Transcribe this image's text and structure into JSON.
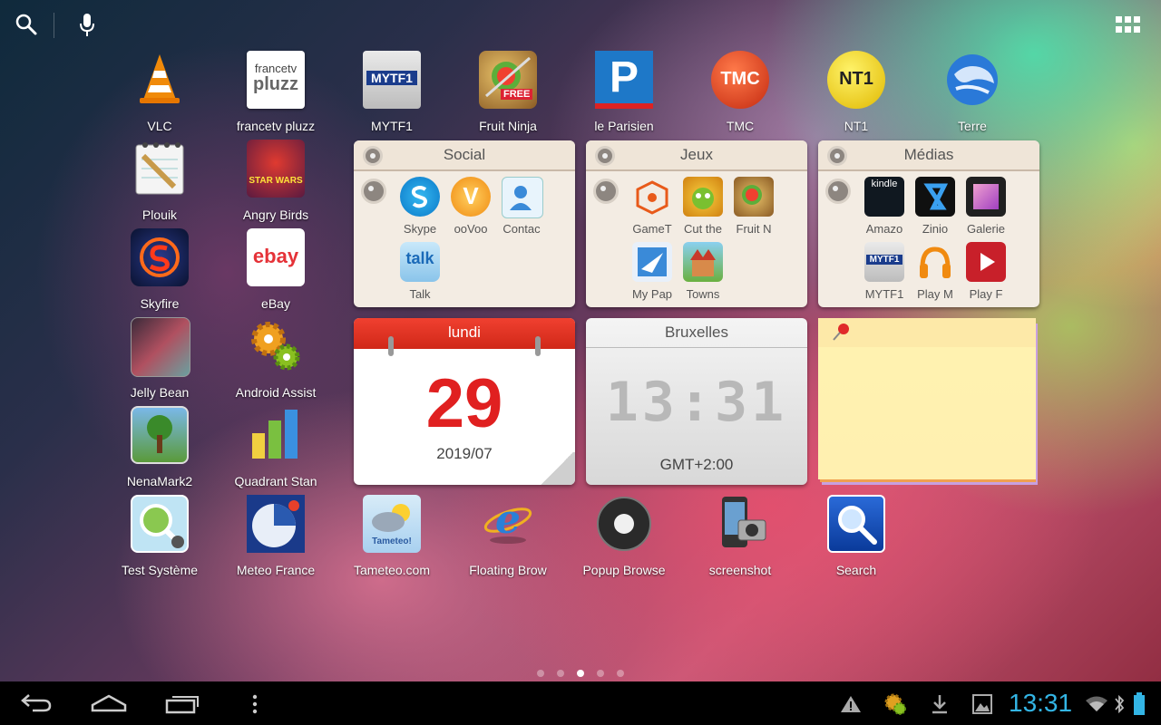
{
  "topbar": {
    "search_icon": "search-icon",
    "mic_icon": "microphone-icon",
    "apps_icon": "app-grid-icon"
  },
  "apps": {
    "vlc": "VLC",
    "francetv_pluzz": "francetv pluzz",
    "mytf1": "MYTF1",
    "fruit_ninja": "Fruit Ninja",
    "le_parisien": "le Parisien",
    "tmc": "TMC",
    "nt1": "NT1",
    "terre": "Terre",
    "plouik": "Plouik",
    "angry_birds": "Angry Birds",
    "skyfire": "Skyfire",
    "ebay": "eBay",
    "jelly_bean": "Jelly Bean",
    "android_assist": "Android Assist",
    "nenamark2": "NenaMark2",
    "quadrant": "Quadrant Stan",
    "test_systeme": "Test Système",
    "meteo_france": "Meteo France",
    "tameteo": "Tameteo.com",
    "floating_browser": "Floating Brow",
    "popup_browser": "Popup Browse",
    "screenshot": "screenshot",
    "search": "Search"
  },
  "icon_text": {
    "francetv": "francetv",
    "pluzz": "pluzz",
    "mytf1": "MYTF1",
    "free": "FREE",
    "p": "P",
    "tmc": "TMC",
    "nt1": "NT1",
    "star_wars": "STAR WARS",
    "ebay": "ebay",
    "talk": "talk",
    "kindle": "kindle",
    "tameteo": "Tameteo!",
    "e": "e",
    "v": "V"
  },
  "folders": {
    "social": {
      "title": "Social",
      "apps": [
        "Skype",
        "ooVoo",
        "Contac",
        "Talk"
      ]
    },
    "jeux": {
      "title": "Jeux",
      "apps": [
        "GameT",
        "Cut the",
        "Fruit N",
        "My Pap",
        "Towns"
      ]
    },
    "medias": {
      "title": "Médias",
      "apps": [
        "Amazo",
        "Zinio",
        "Galerie",
        "MYTF1",
        "Play M",
        "Play F"
      ]
    }
  },
  "calendar": {
    "day": "lundi",
    "date": "29",
    "month": "2019/07"
  },
  "clock": {
    "city": "Bruxelles",
    "time": "13:31",
    "timezone": "GMT+2:00"
  },
  "page_indicator": {
    "count": 5,
    "active": 2
  },
  "statusbar": {
    "time": "13:31",
    "accent": "#33b5e5"
  }
}
